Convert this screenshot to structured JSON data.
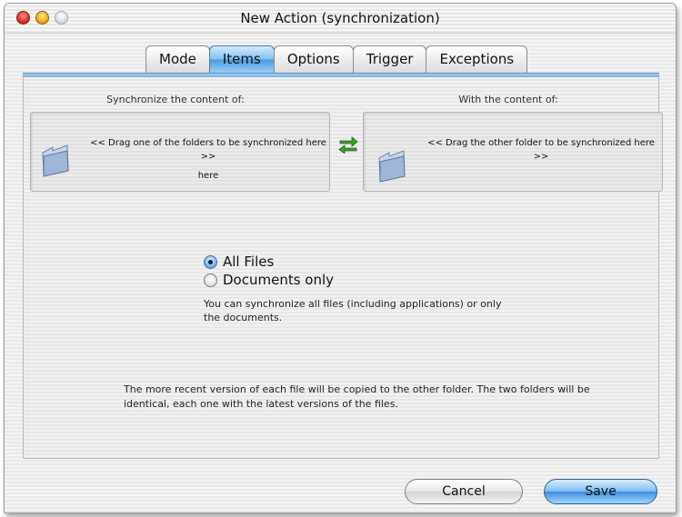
{
  "window": {
    "title": "New Action (synchronization)"
  },
  "tabs": [
    {
      "label": "Mode",
      "active": false
    },
    {
      "label": "Items",
      "active": true
    },
    {
      "label": "Options",
      "active": false
    },
    {
      "label": "Trigger",
      "active": false
    },
    {
      "label": "Exceptions",
      "active": false
    }
  ],
  "left": {
    "heading": "Synchronize the content of:",
    "drop_text": "<< Drag one of the folders to be synchronized here >>",
    "extra_text": "here"
  },
  "right": {
    "heading": "With the content of:",
    "drop_text": "<< Drag the other folder to be synchronized here >>"
  },
  "options": [
    {
      "label": "All Files",
      "selected": true
    },
    {
      "label": "Documents only",
      "selected": false
    }
  ],
  "help_text": "You can synchronize all files (including applications) or only the documents.",
  "footnote": "The more recent version of each file will be copied to the other folder. The two folders will be identical, each one with the latest versions of the files.",
  "buttons": {
    "cancel": "Cancel",
    "save": "Save"
  },
  "colors": {
    "accent": "#5c9ee0",
    "close": "#e0362a",
    "minimize": "#f2b21c"
  }
}
